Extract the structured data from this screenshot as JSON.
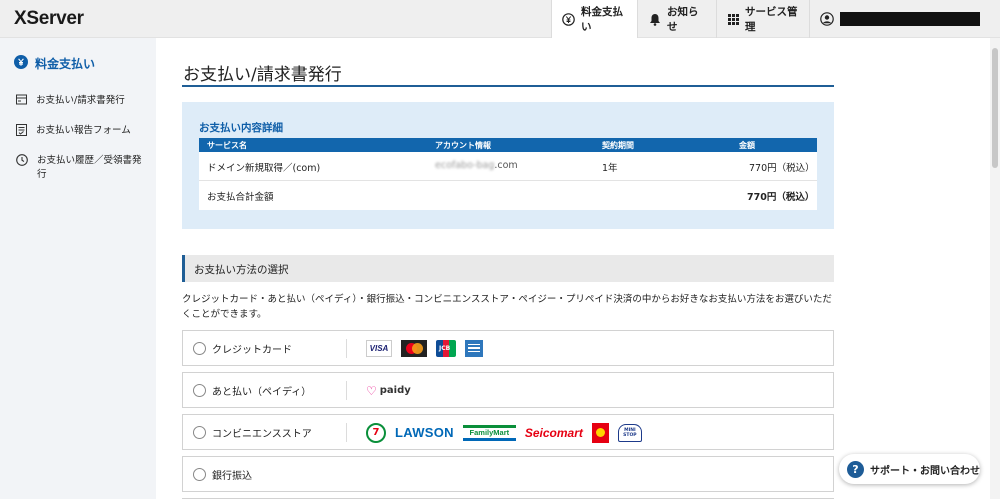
{
  "header": {
    "logo": "XServer",
    "nav": [
      {
        "label": "料金支払い",
        "icon": "yen-circle-icon"
      },
      {
        "label": "お知らせ",
        "icon": "bell-icon"
      },
      {
        "label": "サービス管理",
        "icon": "grid-icon"
      }
    ],
    "user_icon": "user-icon"
  },
  "sidebar": {
    "title": "料金支払い",
    "items": [
      {
        "label": "お支払い/請求書発行",
        "icon": "invoice-icon"
      },
      {
        "label": "お支払い報告フォーム",
        "icon": "report-form-icon"
      },
      {
        "label": "お支払い履歴／受領書発行",
        "icon": "clock-icon"
      }
    ]
  },
  "page": {
    "title": "お支払い/請求書発行"
  },
  "details": {
    "title": "お支払い内容詳細",
    "columns": [
      "サービス名",
      "アカウント情報",
      "契約期間",
      "金額"
    ],
    "row": {
      "service": "ドメイン新規取得／(com)",
      "account_blurred": "ecofabo-bag",
      "account_suffix": ".com",
      "term": "1年",
      "amount": "770円（税込）"
    },
    "total_label": "お支払合計金額",
    "total_amount": "770円（税込）"
  },
  "method": {
    "heading": "お支払い方法の選択",
    "description": "クレジットカード・あと払い（ペイディ）・銀行振込・コンビニエンスストア・ペイジー・プリペイド決済の中からお好きなお支払い方法をお選びいただくことができます。",
    "options": [
      {
        "label": "クレジットカード",
        "brands": [
          "VISA",
          "JCB"
        ]
      },
      {
        "label": "あと払い（ペイディ）",
        "brands": [
          "paidy"
        ]
      },
      {
        "label": "コンビニエンスストア",
        "brands": [
          "LAWSON",
          "FamilyMart",
          "Seicomart",
          "MINI STOP"
        ]
      },
      {
        "label": "銀行振込",
        "brands": []
      }
    ]
  },
  "support": {
    "label": "サポート・お問い合わせ",
    "icon": "question-icon"
  },
  "colors": {
    "accent": "#1f5e96",
    "table_head": "#1266ad",
    "detail_bg": "#deecf8"
  }
}
